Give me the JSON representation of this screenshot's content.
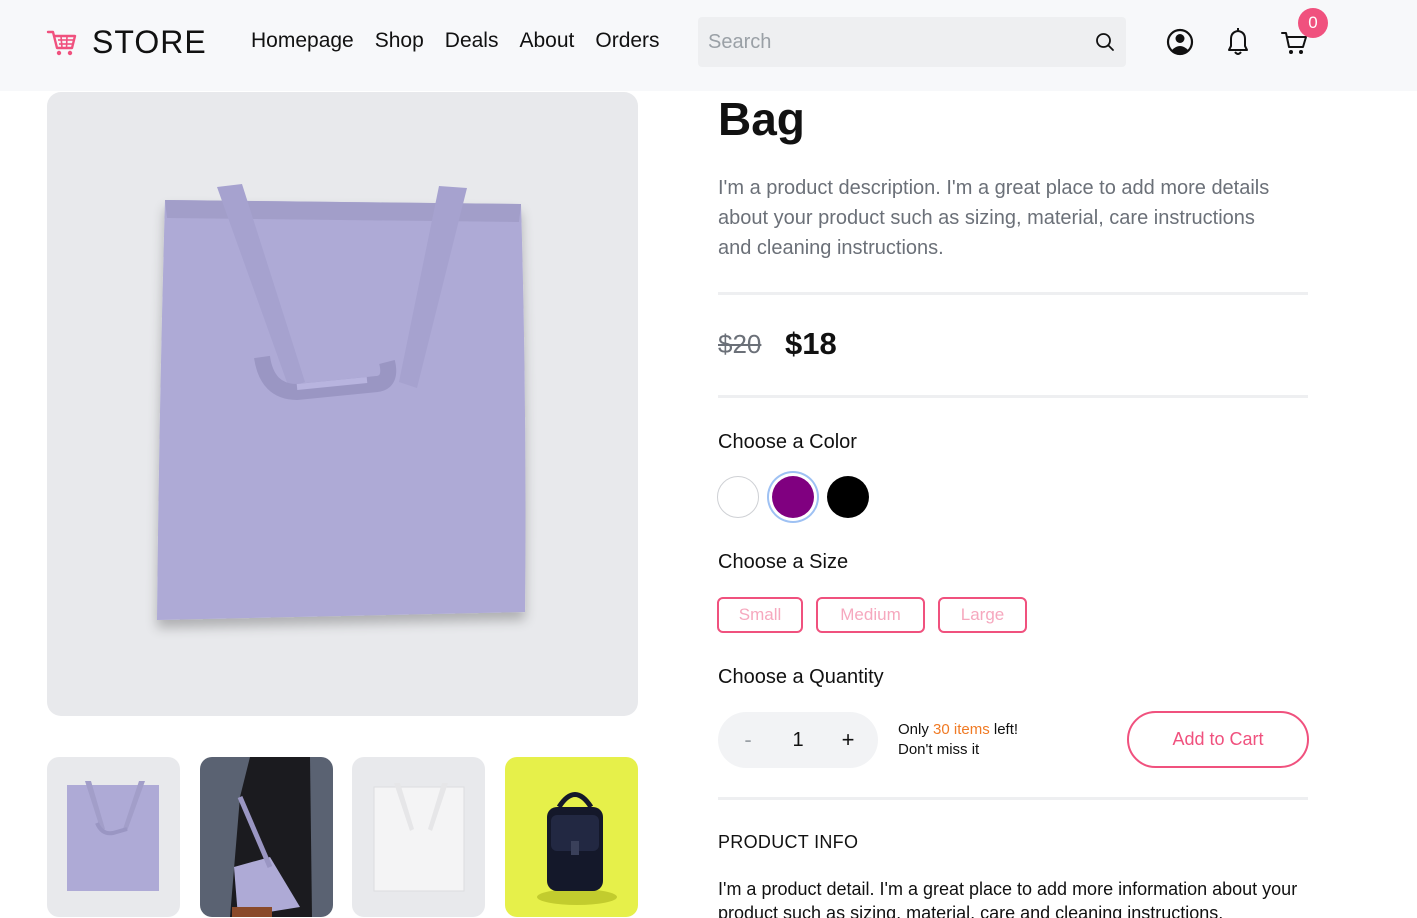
{
  "header": {
    "logo_text": "STORE",
    "nav": [
      "Homepage",
      "Shop",
      "Deals",
      "About",
      "Orders"
    ],
    "search_placeholder": "Search",
    "cart_count": "0"
  },
  "gallery": {
    "main_image": "lavender tote bag",
    "thumbnails": [
      "lavender tote bag",
      "person carrying tote bag",
      "white tote bag",
      "black backpack on yellow"
    ]
  },
  "product": {
    "title": "Bag",
    "description": "I'm a product description. I'm a great place to add more details about your product such as sizing, material, care instructions and cleaning instructions.",
    "old_price": "$20",
    "price": "$18",
    "color_label": "Choose a Color",
    "colors": [
      "#ffffff",
      "#800080",
      "#000000"
    ],
    "selected_color": "#800080",
    "size_label": "Choose a Size",
    "sizes": [
      "Small",
      "Medium",
      "Large"
    ],
    "quantity_label": "Choose a Quantity",
    "quantity": "1",
    "minus": "-",
    "plus": "+",
    "stock_prefix": "Only ",
    "stock_count": "30 items",
    "stock_suffix": " left!",
    "stock_line2": "Don't miss it",
    "add_to_cart": "Add to Cart",
    "info_title": "PRODUCT INFO",
    "info_text": "I'm a product detail. I'm a great place to add more information about your product such as sizing, material, care and cleaning instructions."
  },
  "colors": {
    "accent": "#f0517e",
    "stock_highlight": "#f07a24"
  }
}
